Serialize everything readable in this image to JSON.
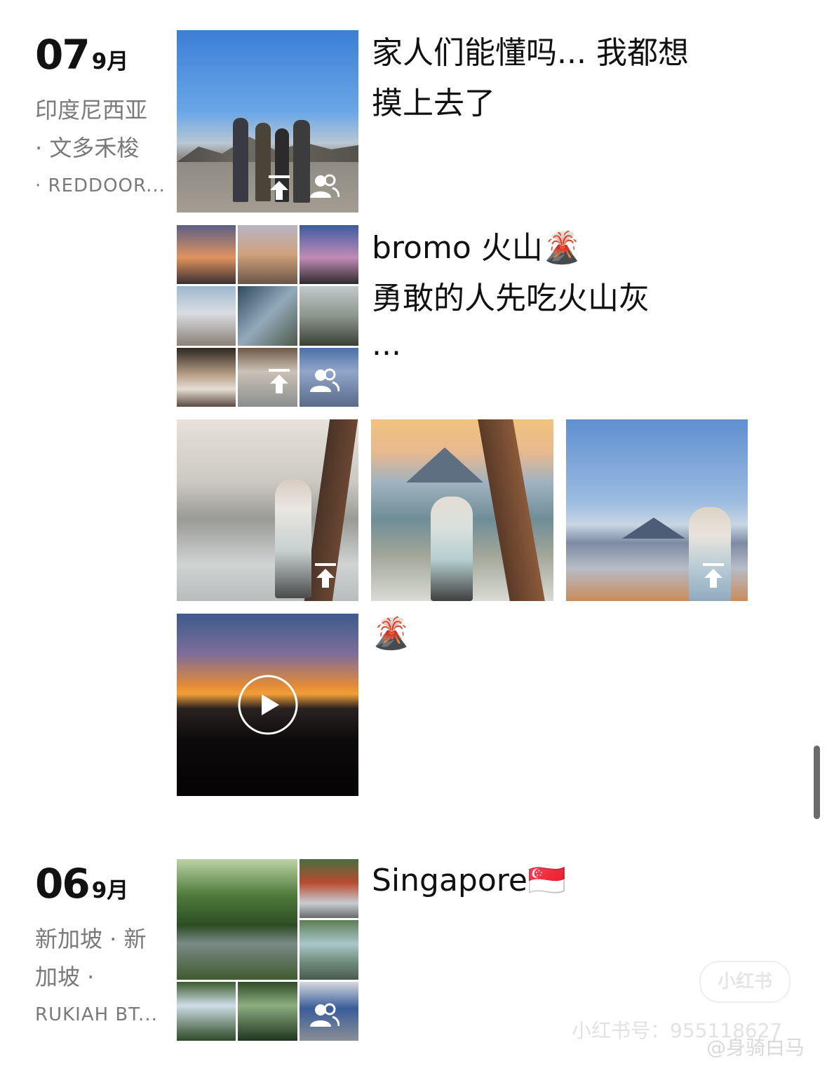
{
  "entries": [
    {
      "day": "07",
      "month": "9月",
      "location_lines": [
        "印度尼西亚",
        "· 文多禾梭",
        "· REDDOOR..."
      ],
      "posts": [
        {
          "type": "single-photo",
          "caption_lines": [
            "家人们能懂吗... 我都想",
            "摸上去了"
          ],
          "overlay_icons": [
            "share-up-icon",
            "people-icon"
          ]
        },
        {
          "type": "photo-grid-9",
          "caption_lines": [
            "bromo 火山🌋",
            "勇敢的人先吃火山灰",
            "..."
          ],
          "overlay_icons": [
            "share-up-icon",
            "people-icon"
          ]
        },
        {
          "type": "photo-row-3",
          "overlay_icons": [
            "share-up-icon",
            "share-up-icon",
            "share-up-icon"
          ]
        },
        {
          "type": "video",
          "caption_lines": [
            "🌋"
          ],
          "overlay_icons": [
            "play-icon"
          ]
        }
      ]
    },
    {
      "day": "06",
      "month": "9月",
      "location_lines": [
        "新加坡 · 新",
        "加坡 ·",
        "RUKIAH BT..."
      ],
      "posts": [
        {
          "type": "photo-collage",
          "caption_lines": [
            "Singapore🇸🇬"
          ],
          "overlay_icons": [
            "people-icon"
          ]
        }
      ]
    }
  ],
  "watermark": {
    "logo_text": "小红书",
    "id_text": "小红书号：955118627",
    "weibo_text": "@身骑白马"
  }
}
